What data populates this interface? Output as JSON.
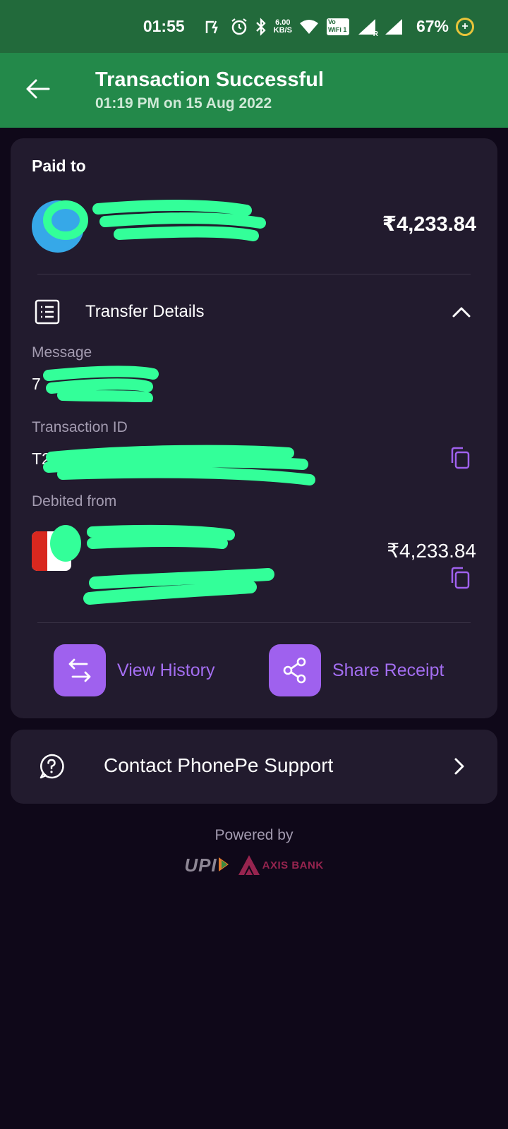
{
  "status_bar": {
    "time": "01:55",
    "net_speed_value": "6.00",
    "net_speed_unit": "KB/S",
    "volte": "Vo",
    "wifi_label": "WiFi",
    "wifi_level": "1",
    "roaming": "R",
    "battery": "67%",
    "battery_symbol": "+"
  },
  "header": {
    "title": "Transaction Successful",
    "subtitle": "01:19 PM on 15 Aug 2022"
  },
  "payment": {
    "paid_to_label": "Paid to",
    "amount": "₹4,233.84"
  },
  "transfer_details": {
    "label": "Transfer Details",
    "message_label": "Message",
    "message_value_visible": "7",
    "transaction_id_label": "Transaction ID",
    "transaction_id_visible": "T2",
    "debited_from_label": "Debited from",
    "debited_amount": "₹4,233.84"
  },
  "actions": {
    "view_history": "View History",
    "share_receipt": "Share Receipt"
  },
  "support": {
    "label": "Contact PhonePe Support"
  },
  "footer": {
    "powered_by": "Powered by",
    "upi_logo_text": "UPI",
    "bank_name": "AXIS BANK"
  },
  "colors": {
    "status_bar": "#226a3b",
    "header": "#23894a",
    "background": "#0f0819",
    "card": "#221b2e",
    "accent_purple": "#9f61ee",
    "redaction": "#33ff99"
  }
}
